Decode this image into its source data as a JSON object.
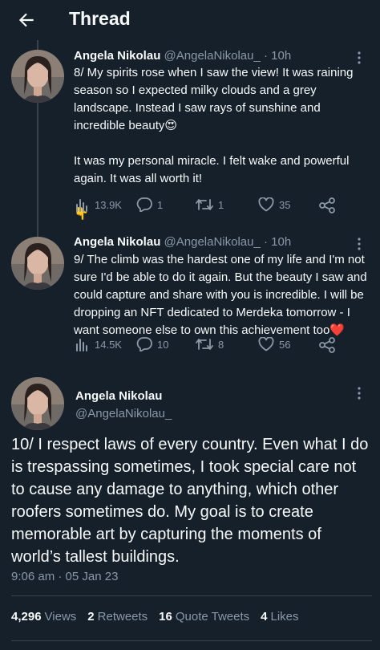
{
  "header": {
    "title": "Thread",
    "back_icon": "arrow-left-icon"
  },
  "colors": {
    "background": "#15202b",
    "text": "#f7f9f9",
    "muted": "#8b98a5",
    "divider": "#38444d",
    "heart": "#f91880"
  },
  "tweets": [
    {
      "name": "Angela Nikolau",
      "handle": "@AngelaNikolau_",
      "time": "· 10h",
      "paragraphs": [
        "8/ My spirits rose when I saw the view! It was raining season so I expected milky clouds and a grey landscape. Instead I saw rays of sunshine and incredible beauty😍",
        "It was my personal miracle. I felt wake and powerful again. It was all worth it!",
        "👇"
      ],
      "views": "13.9K",
      "replies": "1",
      "retweets": "1",
      "likes": "35"
    },
    {
      "name": "Angela Nikolau",
      "handle": "@AngelaNikolau_",
      "time": "· 10h",
      "paragraphs": [
        "9/ The climb was the hardest one of my life and I'm not sure I'd be able to do it again. But the beauty I saw and could capture and share with you is incredible. I will be dropping an NFT dedicated to Merdeka tomorrow - I want someone else to own this achievement too❤️"
      ],
      "views": "14.5K",
      "replies": "10",
      "retweets": "8",
      "likes": "56"
    }
  ],
  "main_tweet": {
    "name": "Angela Nikolau",
    "handle": "@AngelaNikolau_",
    "text": "10/ I respect laws of every country. Even what I do is trespassing sometimes, I took special care not to cause any damage to anything, which other roofers sometimes do. My goal is to create memorable art by capturing the moments of world’s tallest buildings.",
    "timestamp": "9:06 am · 05 Jan 23",
    "stats": {
      "views_count": "4,296",
      "views_label": "Views",
      "retweets_count": "2",
      "retweets_label": "Retweets",
      "quotes_count": "16",
      "quotes_label": "Quote Tweets",
      "likes_count": "4",
      "likes_label": "Likes"
    }
  }
}
